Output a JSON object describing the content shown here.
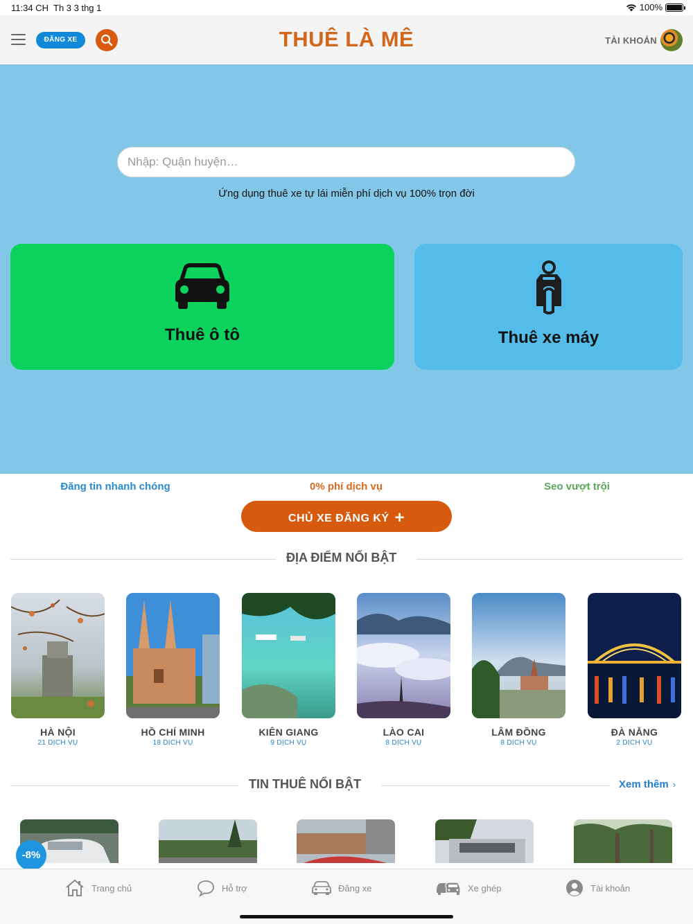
{
  "status_bar": {
    "time": "11:34 CH",
    "date": "Th 3 3 thg 1",
    "battery": "100%"
  },
  "header": {
    "post_button": "ĐĂNG XE",
    "logo": "THUÊ LÀ MÊ",
    "account": "TÀI KHOẢN"
  },
  "hero": {
    "search_placeholder": "Nhập: Quận huyện…",
    "tagline": "Ứng dụng thuê xe tự lái miễn phí dịch vụ 100% trọn đời",
    "car_card": "Thuê ô tô",
    "moto_card": "Thuê xe máy"
  },
  "features": {
    "f1": "Đăng tin nhanh chóng",
    "f2": "0% phí dịch vụ",
    "f3": "Seo vượt trội"
  },
  "owner_button": "CHỦ XE ĐĂNG KÝ",
  "featured_places": {
    "title": "ĐỊA ĐIỂM NỔI BẬT",
    "items": [
      {
        "name": "HÀ NỘI",
        "count": "21 DỊCH VỤ"
      },
      {
        "name": "HỒ CHÍ MINH",
        "count": "18 DỊCH VỤ"
      },
      {
        "name": "KIÊN GIANG",
        "count": "9 DỊCH VỤ"
      },
      {
        "name": "LÀO CAI",
        "count": "8 DỊCH VỤ"
      },
      {
        "name": "LÂM ĐỒNG",
        "count": "8 DỊCH VỤ"
      },
      {
        "name": "ĐÀ NẴNG",
        "count": "2 DỊCH VỤ"
      }
    ]
  },
  "featured_listings": {
    "title": "TIN THUÊ NỔI BẬT",
    "see_more": "Xem thêm",
    "discount": "-8%"
  },
  "tabbar": {
    "home": "Trang chủ",
    "support": "Hỗ trợ",
    "post": "Đăng xe",
    "carpool": "Xe ghép",
    "account": "Tài khoản"
  },
  "colors": {
    "brand_orange": "#d85a0e",
    "hero_blue": "#82c6e8",
    "car_green": "#0bd35e",
    "moto_blue": "#54bce9",
    "link_blue": "#1f7fd0"
  },
  "icons": [
    "menu-icon",
    "search-icon",
    "car-icon",
    "scooter-icon",
    "plus-icon",
    "chevron-right-icon",
    "home-icon",
    "chat-icon",
    "car-outline-icon",
    "carpool-icon",
    "user-icon",
    "wifi-icon",
    "battery-icon"
  ]
}
